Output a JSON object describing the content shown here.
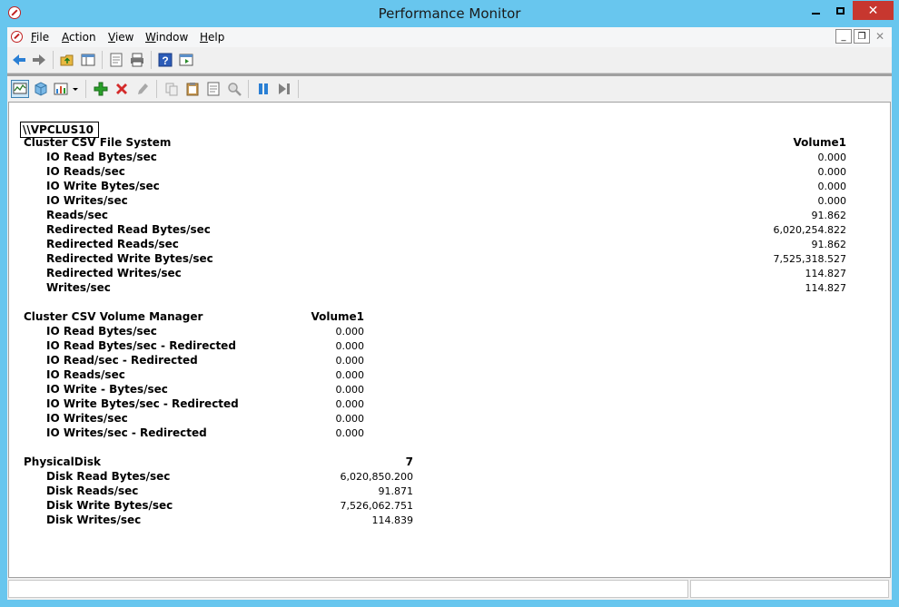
{
  "window": {
    "title": "Performance Monitor"
  },
  "menu": {
    "items": [
      {
        "label": "File",
        "accel": "F",
        "rest": "ile"
      },
      {
        "label": "Action",
        "accel": "A",
        "rest": "ction"
      },
      {
        "label": "View",
        "accel": "V",
        "rest": "iew"
      },
      {
        "label": "Window",
        "accel": "W",
        "rest": "indow"
      },
      {
        "label": "Help",
        "accel": "H",
        "rest": "elp"
      }
    ]
  },
  "report": {
    "machine": "\\\\VPCLUS10",
    "objects": [
      {
        "name": "Cluster CSV File System",
        "instance": "Volume1",
        "counters": [
          {
            "name": "IO Read Bytes/sec",
            "value": "0.000"
          },
          {
            "name": "IO Reads/sec",
            "value": "0.000"
          },
          {
            "name": "IO Write Bytes/sec",
            "value": "0.000"
          },
          {
            "name": "IO Writes/sec",
            "value": "0.000"
          },
          {
            "name": "Reads/sec",
            "value": "91.862"
          },
          {
            "name": "Redirected Read Bytes/sec",
            "value": "6,020,254.822"
          },
          {
            "name": "Redirected Reads/sec",
            "value": "91.862"
          },
          {
            "name": "Redirected Write Bytes/sec",
            "value": "7,525,318.527"
          },
          {
            "name": "Redirected Writes/sec",
            "value": "114.827"
          },
          {
            "name": "Writes/sec",
            "value": "114.827"
          }
        ]
      },
      {
        "name": "Cluster CSV Volume Manager",
        "instance": "Volume1",
        "counters": [
          {
            "name": "IO Read Bytes/sec",
            "value": "0.000"
          },
          {
            "name": "IO Read Bytes/sec - Redirected",
            "value": "0.000"
          },
          {
            "name": "IO Read/sec - Redirected",
            "value": "0.000"
          },
          {
            "name": "IO Reads/sec",
            "value": "0.000"
          },
          {
            "name": "IO Write - Bytes/sec",
            "value": "0.000"
          },
          {
            "name": "IO Write Bytes/sec - Redirected",
            "value": "0.000"
          },
          {
            "name": "IO Writes/sec",
            "value": "0.000"
          },
          {
            "name": "IO Writes/sec - Redirected",
            "value": "0.000"
          }
        ]
      },
      {
        "name": "PhysicalDisk",
        "instance": "7",
        "counters": [
          {
            "name": "Disk Read Bytes/sec",
            "value": "6,020,850.200"
          },
          {
            "name": "Disk Reads/sec",
            "value": "91.871"
          },
          {
            "name": "Disk Write Bytes/sec",
            "value": "7,526,062.751"
          },
          {
            "name": "Disk Writes/sec",
            "value": "114.839"
          }
        ]
      }
    ]
  }
}
